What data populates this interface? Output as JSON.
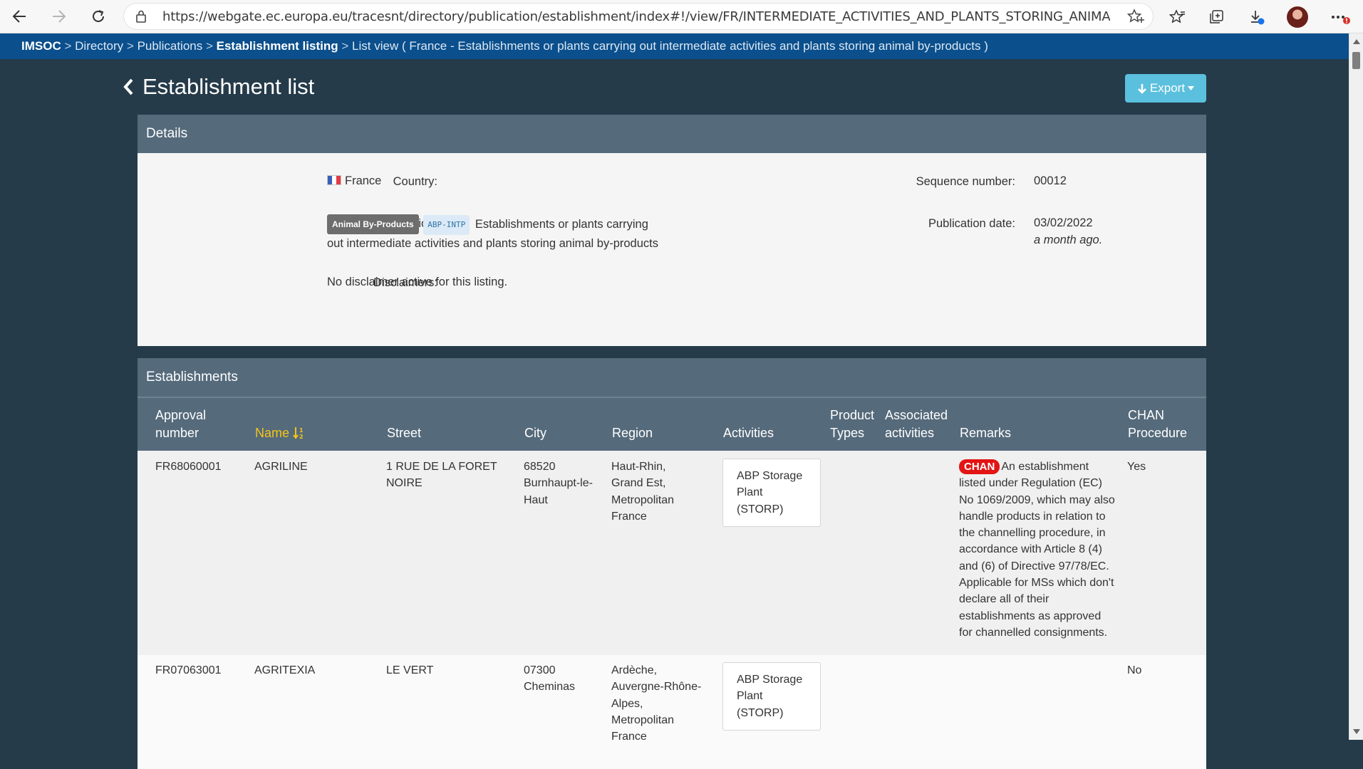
{
  "browser": {
    "url": "https://webgate.ec.europa.eu/tracesnt/directory/publication/establishment/index#!/view/FR/INTERMEDIATE_ACTIVITIES_AND_PLANTS_STORING_ANIMAL_BYPRODUCTS_E..."
  },
  "breadcrumb": {
    "items": [
      "IMSOC",
      "Directory",
      "Publications",
      "Establishment listing"
    ],
    "separator": ">",
    "current": "List view ( France - Establishments or plants carrying out intermediate activities and plants storing animal by-products )"
  },
  "page": {
    "title": "Establishment list",
    "export_label": "Export"
  },
  "details": {
    "heading": "Details",
    "country_label": "Country:",
    "country_value": "France",
    "section_label": "Section:",
    "section_badge": "Animal By-Products",
    "section_code": "ABP-INTP",
    "section_text_1": "Establishments or plants carrying",
    "section_text_2": "out intermediate activities and plants storing animal by-products",
    "disclaimers_label": "Disclaimers:",
    "disclaimers_value": "No disclaimer active for this listing.",
    "sequence_label": "Sequence number:",
    "sequence_value": "00012",
    "publication_label": "Publication date:",
    "publication_value": "03/02/2022",
    "publication_relative": "a month ago."
  },
  "establishments": {
    "heading": "Establishments",
    "columns": {
      "approval_1": "Approval",
      "approval_2": "number",
      "name": "Name",
      "street": "Street",
      "city": "City",
      "region": "Region",
      "activities": "Activities",
      "product_1": "Product",
      "product_2": "Types",
      "assoc_1": "Associated",
      "assoc_2": "activities",
      "remarks": "Remarks",
      "chan_1": "CHAN",
      "chan_2": "Procedure"
    },
    "rows": [
      {
        "approval": "FR68060001",
        "name": "AGRILINE",
        "street_1": "1 RUE DE LA FORET",
        "street_2": "NOIRE",
        "city_1": "68520",
        "city_2": "Burnhaupt-le-",
        "city_3": "Haut",
        "region_1": "Haut-Rhin,",
        "region_2": "Grand Est,",
        "region_3": "Metropolitan",
        "region_4": "France",
        "activity_1": "ABP Storage",
        "activity_2": "Plant",
        "activity_3": "(STORP)",
        "remark_badge": "CHAN",
        "remark_1": "An establishment",
        "remark_2": "listed under Regulation (EC)",
        "remark_3": "No 1069/2009, which may also",
        "remark_4": "handle products in relation to",
        "remark_5": "the channelling procedure, in",
        "remark_6": "accordance with Article 8 (4)",
        "remark_7": "and (6) of Directive 97/78/EC.",
        "remark_8": "Applicable for MSs which don't",
        "remark_9": "declare all of their",
        "remark_10": "establishments as approved",
        "remark_11": "for channelled consignments.",
        "chan": "Yes"
      },
      {
        "approval": "FR07063001",
        "name": "AGRITEXIA",
        "street_1": "LE VERT",
        "city_1": "07300",
        "city_2": "Cheminas",
        "region_1": "Ardèche,",
        "region_2": "Auvergne-Rhône-",
        "region_3": "Alpes,",
        "region_4": "Metropolitan",
        "region_5": "France",
        "activity_1": "ABP Storage",
        "activity_2": "Plant",
        "activity_3": "(STORP)",
        "chan": "No"
      }
    ]
  }
}
